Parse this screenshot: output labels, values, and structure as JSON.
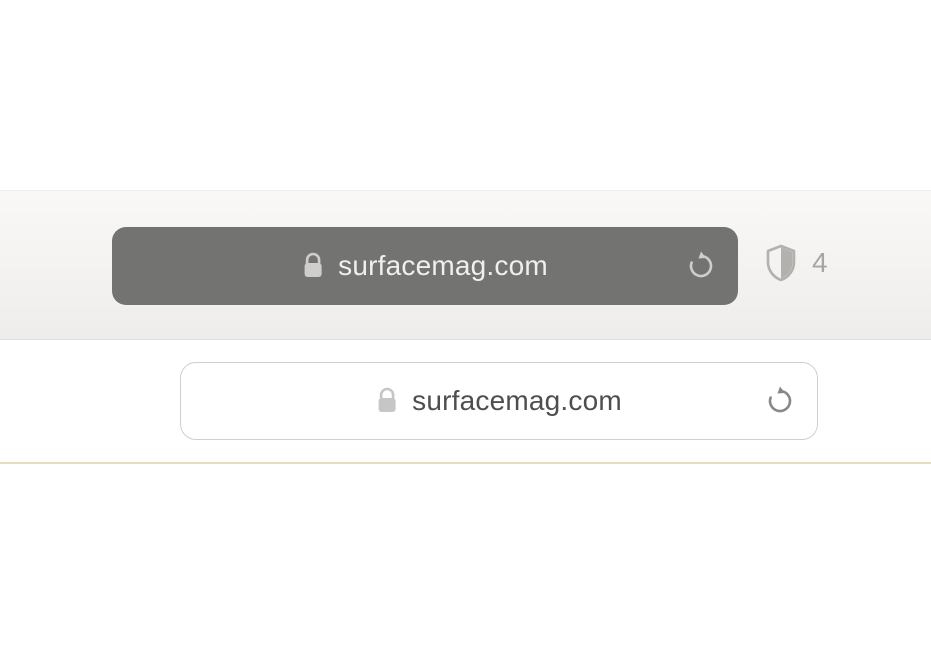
{
  "toolbar": {
    "dark": {
      "url": "surfacemag.com"
    },
    "privacy": {
      "count": "4"
    },
    "light": {
      "url": "surfacemag.com"
    }
  }
}
